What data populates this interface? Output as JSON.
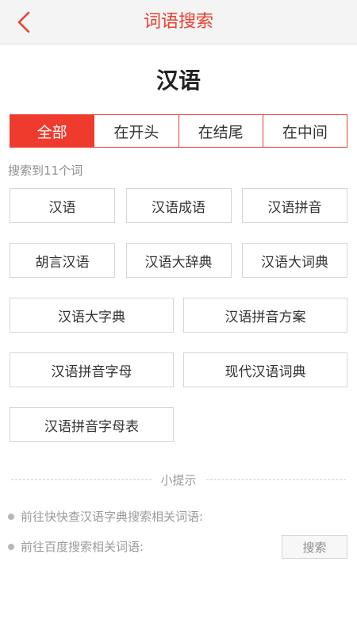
{
  "header": {
    "title": "词语搜索",
    "back_icon": "chevron-left-icon",
    "accent": "#e8402f"
  },
  "query": {
    "keyword": "汉语"
  },
  "tabs": [
    {
      "label": "全部",
      "active": true
    },
    {
      "label": "在开头",
      "active": false
    },
    {
      "label": "在结尾",
      "active": false
    },
    {
      "label": "在中间",
      "active": false
    }
  ],
  "results": {
    "count_text": "搜索到11个词",
    "words": [
      "汉语",
      "汉语成语",
      "汉语拼音",
      "胡言汉语",
      "汉语大辞典",
      "汉语大词典",
      "汉语大字典",
      "汉语拼音方案",
      "汉语拼音字母",
      "现代汉语词典",
      "汉语拼音字母表"
    ]
  },
  "tips": {
    "title": "小提示",
    "line1": "前往快快查汉语字典搜索相关词语:",
    "line2": "前往百度搜索相关词语:",
    "search_button": "搜索"
  }
}
